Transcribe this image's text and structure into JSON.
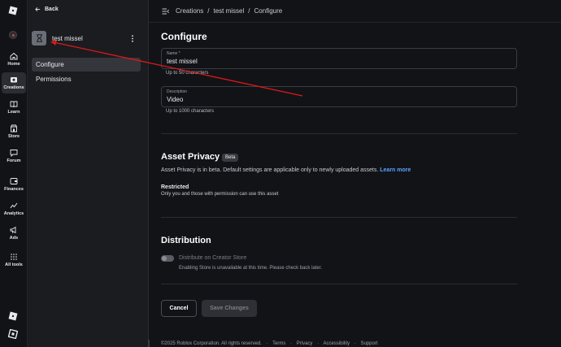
{
  "rail": {
    "items": [
      {
        "label": "Home",
        "icon": "home-icon"
      },
      {
        "label": "Creations",
        "icon": "creations-icon",
        "active": true
      },
      {
        "label": "Learn",
        "icon": "learn-icon"
      },
      {
        "label": "Store",
        "icon": "store-icon"
      },
      {
        "label": "Forum",
        "icon": "forum-icon"
      },
      {
        "label": "Finances",
        "icon": "finances-icon"
      },
      {
        "label": "Analytics",
        "icon": "analytics-icon"
      },
      {
        "label": "Ads",
        "icon": "ads-icon"
      },
      {
        "label": "All tools",
        "icon": "all-tools-icon"
      }
    ]
  },
  "side": {
    "back_label": "Back",
    "asset_name": "test missel",
    "nav": [
      {
        "label": "Configure",
        "active": true
      },
      {
        "label": "Permissions",
        "active": false
      }
    ]
  },
  "breadcrumb": {
    "items": [
      "Creations",
      "/",
      "test missel",
      "/",
      "Configure"
    ]
  },
  "main": {
    "title": "Configure",
    "name_field": {
      "label": "Name *",
      "value": "test missel",
      "hint": "Up to 50 characters"
    },
    "description_field": {
      "label": "Description",
      "value": "Video",
      "hint": "Up to 1000 characters"
    },
    "privacy": {
      "title": "Asset Privacy",
      "badge": "Beta",
      "text": "Asset Privacy is in beta. Default settings are applicable only to newly uploaded assets.",
      "link": "Learn more",
      "restricted_label": "Restricted",
      "restricted_desc": "Only you and those with permission can use this asset"
    },
    "distribution": {
      "title": "Distribution",
      "toggle_label": "Distribute on Creator Store",
      "toggle_on": false,
      "note": "Enabling Store is unavailable at this time. Please check back later."
    },
    "cancel_label": "Cancel",
    "save_label": "Save Changes"
  },
  "footer": {
    "items": [
      "©2025 Roblox Corporation. All rights reserved.",
      "·",
      "Terms",
      "·",
      "Privacy",
      "·",
      "Accessibility",
      "·",
      "Support"
    ]
  },
  "colors": {
    "background": "#121317",
    "sidebar": "#1b1c20",
    "link": "#5aa2ff",
    "annotation": "#e01818"
  }
}
